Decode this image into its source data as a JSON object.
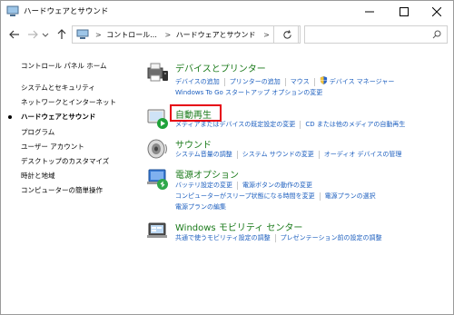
{
  "window": {
    "title": "ハードウェアとサウンド"
  },
  "address": {
    "crumbs": [
      "コントロール...",
      "ハードウェアとサウンド"
    ],
    "search_placeholder": ""
  },
  "leftnav": {
    "items": [
      {
        "label": "コントロール パネル ホーム",
        "active": false
      },
      {
        "label": "システムとセキュリティ",
        "active": false
      },
      {
        "label": "ネットワークとインターネット",
        "active": false
      },
      {
        "label": "ハードウェアとサウンド",
        "active": true
      },
      {
        "label": "プログラム",
        "active": false
      },
      {
        "label": "ユーザー アカウント",
        "active": false
      },
      {
        "label": "デスクトップのカスタマイズ",
        "active": false
      },
      {
        "label": "時計と地域",
        "active": false
      },
      {
        "label": "コンピューターの簡単操作",
        "active": false
      }
    ]
  },
  "sections": {
    "devices": {
      "title": "デバイスとプリンター",
      "line1": [
        "デバイスの追加",
        "プリンターの追加",
        "マウス",
        "デバイス マネージャー"
      ],
      "line2": [
        "Windows To Go スタートアップ オプションの変更"
      ]
    },
    "autoplay": {
      "title": "自動再生",
      "line1": [
        "メディアまたはデバイスの既定設定の変更",
        "CD または他のメディアの自動再生"
      ]
    },
    "sound": {
      "title": "サウンド",
      "line1": [
        "システム音量の調整",
        "システム サウンドの変更",
        "オーディオ デバイスの管理"
      ]
    },
    "power": {
      "title": "電源オプション",
      "line1": [
        "バッテリ設定の変更",
        "電源ボタンの動作の変更"
      ],
      "line2": [
        "コンピューターがスリープ状態になる時間を変更",
        "電源プランの選択"
      ],
      "line3": [
        "電源プランの編集"
      ]
    },
    "mobility": {
      "title": "Windows モビリティ センター",
      "line1": [
        "共通で使うモビリティ設定の調整",
        "プレゼンテーション前の設定の調整"
      ]
    }
  },
  "colors": {
    "section_title": "#1a7a1a",
    "link": "#1d5fbf",
    "highlight": "#e60012"
  }
}
